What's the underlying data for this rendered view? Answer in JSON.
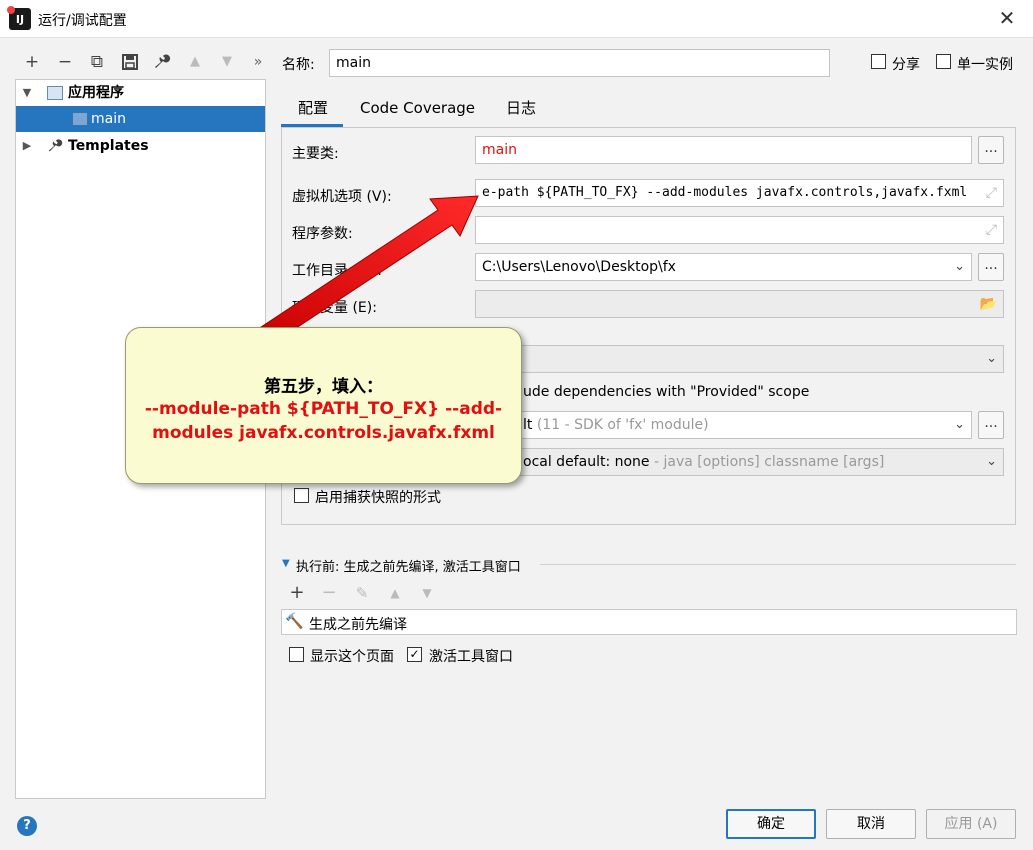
{
  "window": {
    "title": "运行/调试配置",
    "app_icon": "intellij-icon",
    "close": "✕"
  },
  "left_toolbar": {
    "add": "+",
    "remove": "−",
    "copy": "⧉",
    "save": "🖫",
    "wrench": "🔧",
    "up": "▲",
    "down": "▼",
    "more": "»"
  },
  "tree": {
    "items": [
      {
        "label": "应用程序",
        "expanded": true
      },
      {
        "label": "main",
        "selected": true
      },
      {
        "label": "Templates",
        "expanded": false
      }
    ]
  },
  "header": {
    "name_label": "名称:",
    "name_value": "main",
    "share_label": "分享",
    "single_instance_label": "单一实例"
  },
  "tabs": [
    {
      "label": "配置",
      "active": true
    },
    {
      "label": "Code Coverage"
    },
    {
      "label": "日志"
    }
  ],
  "form": {
    "main_class_label": "主要类:",
    "main_class_value": "main",
    "vm_options_label": "虚拟机选项 (V):",
    "vm_options_value": "e-path ${PATH_TO_FX} --add-modules javafx.controls,javafx.fxml",
    "program_args_label": "程序参数:",
    "program_args_value": "",
    "working_dir_label": "工作目录 (W):",
    "working_dir_value": "C:\\Users\\Lenovo\\Desktop\\fx",
    "env_vars_label": "环境变量 (E):",
    "env_vars_value": "",
    "include_provided_label": "ude dependencies with \"Provided\" scope",
    "jre_value": "lt",
    "jre_hint": " (11 - SDK of 'fx' module)",
    "shorten_value": "ocal default: none",
    "shorten_hint": " - java [options] classname [args]",
    "snapshot_label": "启用捕获快照的形式"
  },
  "callout": {
    "line1": "第五步，填入：",
    "line2": "--module-path ${PATH_TO_FX} --add-modules javafx.controls.javafx.fxml",
    "color": "#e01010"
  },
  "before_launch": {
    "title": "执行前: 生成之前先编译, 激活工具窗口",
    "task": "生成之前先编译",
    "show_page_label": "显示这个页面",
    "activate_window_label": "激活工具窗口"
  },
  "buttons": {
    "ok": "确定",
    "cancel": "取消",
    "apply": "应用 (A)",
    "help": "?"
  },
  "colors": {
    "accent": "#2675bf",
    "error_text": "#e01010"
  }
}
